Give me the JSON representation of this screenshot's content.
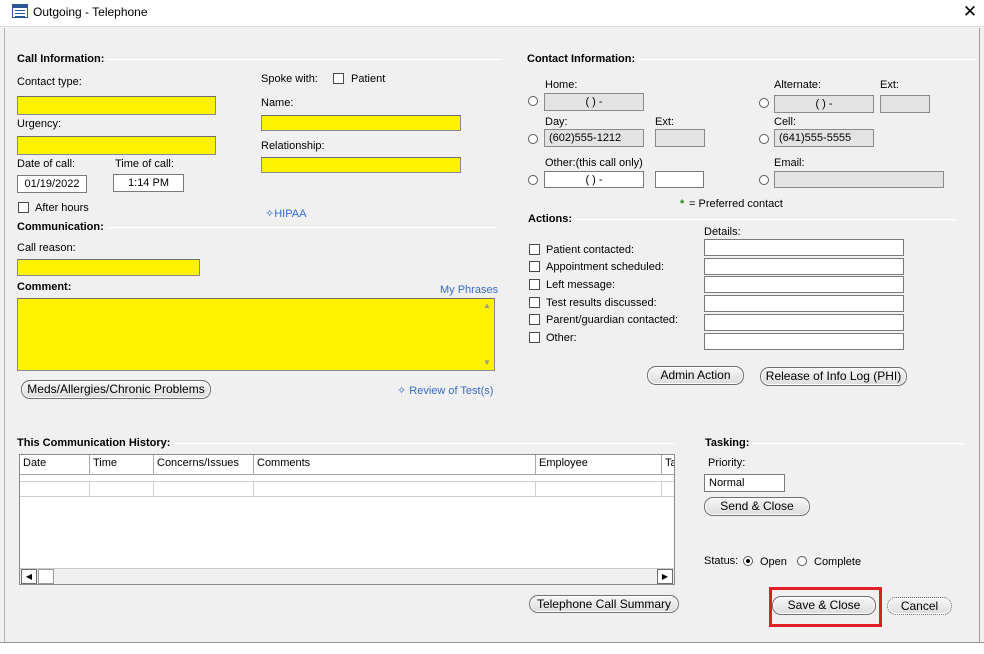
{
  "window": {
    "title": "Outgoing - Telephone",
    "close_glyph": "✕"
  },
  "call_info": {
    "section_title": "Call Information:",
    "contact_type_label": "Contact type:",
    "urgency_label": "Urgency:",
    "date_label": "Date of call:",
    "date_value": "01/19/2022",
    "time_label": "Time of call:",
    "time_value": "1:14 PM",
    "after_hours_label": "After hours",
    "spoke_with_label": "Spoke with:",
    "patient_label": "Patient",
    "name_label": "Name:",
    "relationship_label": "Relationship:",
    "hipaa_link": "✧HIPAA"
  },
  "communication": {
    "section_title": "Communication:",
    "call_reason_label": "Call reason:",
    "comment_label": "Comment:",
    "my_phrases_link": "My Phrases",
    "meds_button": "Meds/Allergies/Chronic Problems",
    "review_link": "✧ Review of Test(s)"
  },
  "contact_info": {
    "section_title": "Contact Information:",
    "home_label": "Home:",
    "home_value": "(   )   -",
    "alternate_label": "Alternate:",
    "alternate_value": "(   )   -",
    "ext_label": "Ext:",
    "day_label": "Day:",
    "day_value": "(602)555-1212",
    "day_ext_label": "Ext:",
    "cell_label": "Cell:",
    "cell_value": "(641)555-5555",
    "other_label": "Other:(this call only)",
    "other_value": "(   )   -",
    "email_label": "Email:",
    "preferred_star": "*",
    "preferred_note": "= Preferred contact"
  },
  "actions": {
    "section_title": "Actions:",
    "details_label": "Details:",
    "items": [
      {
        "label": "Patient contacted:"
      },
      {
        "label": "Appointment scheduled:"
      },
      {
        "label": "Left message:"
      },
      {
        "label": "Test results discussed:"
      },
      {
        "label": "Parent/guardian contacted:"
      },
      {
        "label": "Other:"
      }
    ],
    "admin_button": "Admin Action",
    "release_button": "Release of Info Log (PHI)"
  },
  "history": {
    "section_title": "This Communication History:",
    "columns": [
      "Date",
      "Time",
      "Concerns/Issues",
      "Comments",
      "Employee",
      "Ta"
    ],
    "summary_button": "Telephone Call Summary"
  },
  "tasking": {
    "section_title": "Tasking:",
    "priority_label": "Priority:",
    "priority_value": "Normal",
    "send_close_button": "Send & Close",
    "status_label": "Status:",
    "status_open": "Open",
    "status_complete": "Complete"
  },
  "footer": {
    "save_close_button": "Save & Close",
    "cancel_button": "Cancel"
  },
  "colors": {
    "required_field": "#fff200",
    "link": "#3a6cc9",
    "highlight": "#e11d26",
    "preferred_star": "#1a8a1a"
  }
}
